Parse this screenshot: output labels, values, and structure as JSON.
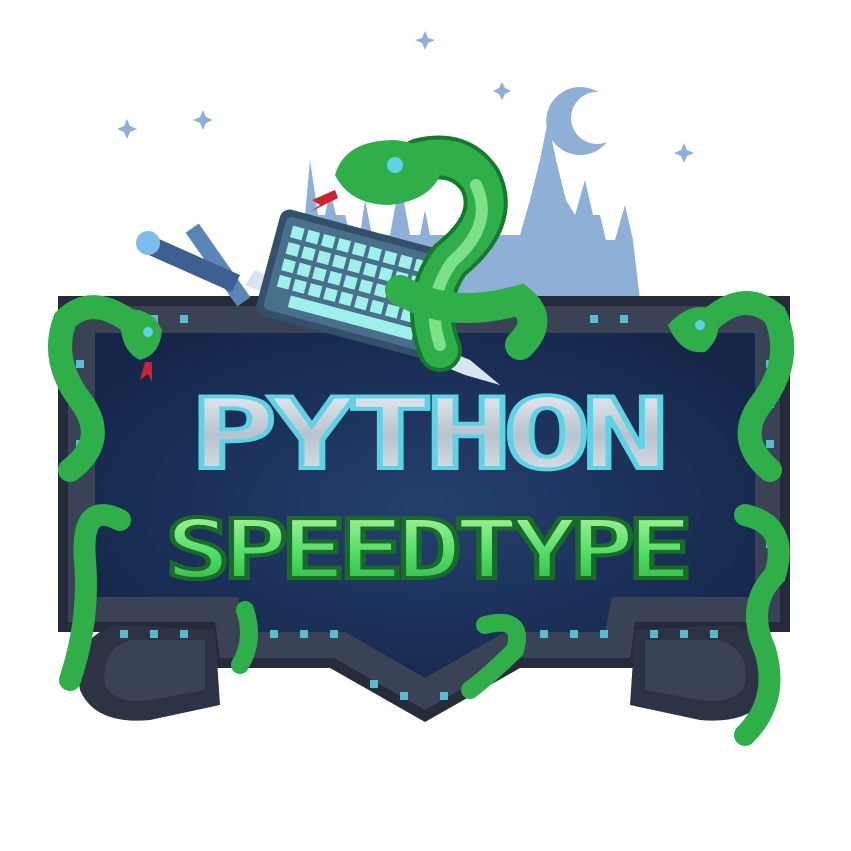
{
  "logo": {
    "title_line1": "PYTHON",
    "title_line2": "SPEEDTYPE"
  },
  "colors": {
    "background": "#ffffff",
    "star": "#8fb0d6",
    "moon": "#8fb0d6",
    "castle": "#8fb0d6",
    "frame_stone": "#3a4256",
    "frame_stone_dark": "#252b3b",
    "panel": "#1d3158",
    "panel_dark": "#142442",
    "rune_glow": "#5fd3e6",
    "snake_green": "#2fae4a",
    "snake_light": "#7fe08a",
    "snake_dark": "#167a2d",
    "title_silver": "#c8d0da",
    "title_outline": "#5fd3e6",
    "title_green": "#6cef77",
    "title_green_outline": "#1a6a2a",
    "keyboard": "#4a6f8c",
    "keys": "#9ff0ea",
    "sword_blade": "#d8e4f0",
    "sword_hilt": "#5b84b8"
  },
  "icons": {
    "stars": "sparkle-star-icon",
    "moon": "crescent-moon-icon",
    "castle": "castle-silhouette-icon",
    "snake": "snake-icon",
    "keyboard": "keyboard-icon",
    "sword": "sword-icon"
  }
}
